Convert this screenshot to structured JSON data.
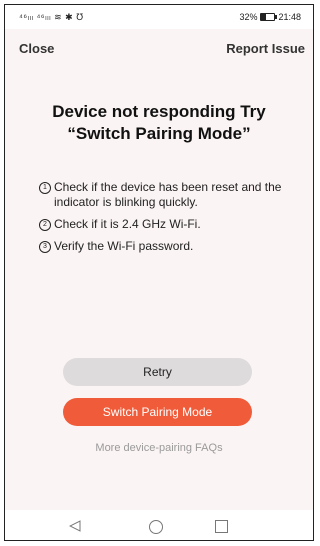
{
  "status_bar": {
    "left": "⁴⁶ₗₗₗ ⁴⁶ₗₗₗ ≋ ✱ ℧",
    "battery_text": "32%",
    "battery_level": 0.32,
    "time": "21:48"
  },
  "nav": {
    "close_label": "Close",
    "report_label": "Report Issue"
  },
  "title": "Device not responding Try “Switch Pairing Mode”",
  "steps": [
    {
      "num": "1",
      "text": "Check if the device has been reset and the indicator is blinking quickly."
    },
    {
      "num": "2",
      "text": "Check if it is 2.4 GHz Wi-Fi."
    },
    {
      "num": "3",
      "text": "Verify the Wi-Fi password."
    }
  ],
  "buttons": {
    "retry": "Retry",
    "switch": "Switch Pairing Mode"
  },
  "faq_link": "More device-pairing FAQs",
  "colors": {
    "primary": "#f05c3a",
    "secondary_button": "#dedbdd",
    "background": "#fbf4f4"
  },
  "icons": {
    "back": "back-triangle-icon",
    "home": "home-circle-icon",
    "recent": "recent-square-icon"
  }
}
